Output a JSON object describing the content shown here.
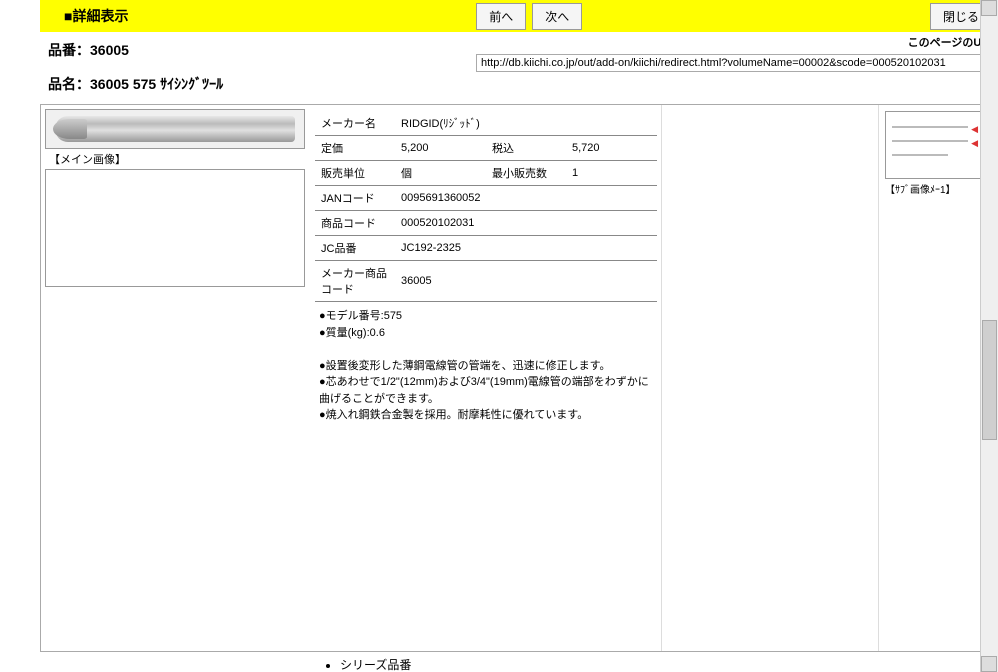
{
  "header": {
    "title": "■詳細表示",
    "prev": "前へ",
    "next": "次へ",
    "close": "閉じる"
  },
  "url": {
    "label": "このページのURL",
    "value": "http://db.kiichi.co.jp/out/add-on/kiichi/redirect.html?volumeName=00002&scode=000520102031"
  },
  "meta": {
    "code_label": "品番：",
    "code_value": "36005",
    "name_label": "品名：",
    "name_value": "36005 575 ｻｲｼﾝｸﾞﾂｰﾙ"
  },
  "main_image_caption": "【メイン画像】",
  "spec": {
    "maker_label": "メーカー名",
    "maker_value": "RIDGID(ﾘｼﾞｯﾄﾞ)",
    "price_label": "定価",
    "price_value": "5,200",
    "tax_label": "税込",
    "tax_value": "5,720",
    "unit_label": "販売単位",
    "unit_value": "個",
    "minqty_label": "最小販売数",
    "minqty_value": "1",
    "jan_label": "JANコード",
    "jan_value": "0095691360052",
    "prodcode_label": "商品コード",
    "prodcode_value": "000520102031",
    "jc_label": "JC品番",
    "jc_value": "JC192-2325",
    "makercode_label": "メーカー商品コード",
    "makercode_value": "36005"
  },
  "desc": {
    "line1": "●モデル番号:575",
    "line2": "●質量(kg):0.6",
    "line3": "●設置後変形した薄鋼電線管の管端を、迅速に修正します。",
    "line4": "●芯あわせで1/2\"(12mm)および3/4\"(19mm)電線管の端部をわずかに曲げることができます。",
    "line5": "●焼入れ鋼鉄合金製を採用。耐摩耗性に優れています。"
  },
  "thumb_caption": "【ｻﾌﾞ画像ﾒｰ1】",
  "bottom_item": "シリーズ品番"
}
